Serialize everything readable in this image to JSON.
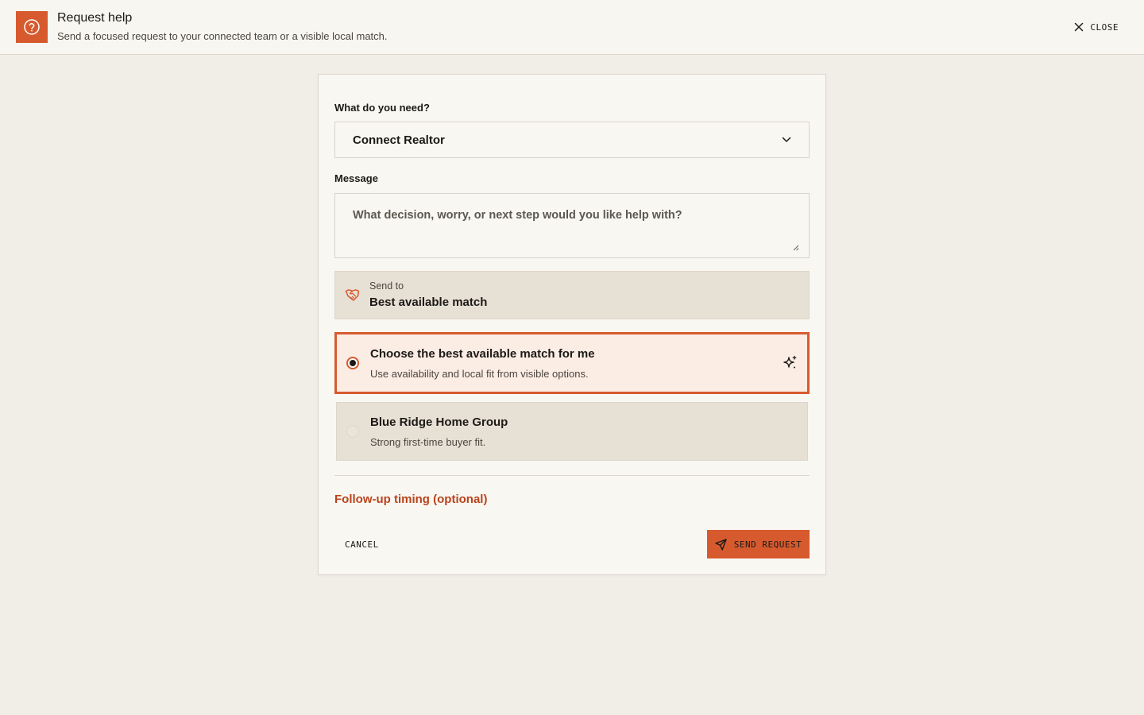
{
  "header": {
    "title": "Request help",
    "subtitle": "Send a focused request to your connected team or a visible local match.",
    "icon": "help-circle-icon",
    "close_label": "CLOSE"
  },
  "form": {
    "need_label": "What do you need?",
    "need_value": "Connect Realtor",
    "message_label": "Message",
    "message_placeholder": "What decision, worry, or next step would you like help with?",
    "send_to_caption": "Send to",
    "send_to_value": "Best available match",
    "options": [
      {
        "title": "Choose the best available match for me",
        "description": "Use availability and local fit from visible options.",
        "selected": true,
        "icon": "sparkle-icon"
      },
      {
        "title": "Blue Ridge Home Group",
        "description": "Strong first-time buyer fit.",
        "selected": false
      }
    ],
    "followup_label": "Follow-up timing (optional)",
    "cancel_label": "CANCEL",
    "send_label": "SEND REQUEST"
  },
  "colors": {
    "accent": "#d75a2e",
    "background": "#f1ede7",
    "card": "#f9f7f2",
    "option_bg": "#e7e0d5",
    "selected_bg": "#fbece4",
    "link": "#b8431c"
  }
}
